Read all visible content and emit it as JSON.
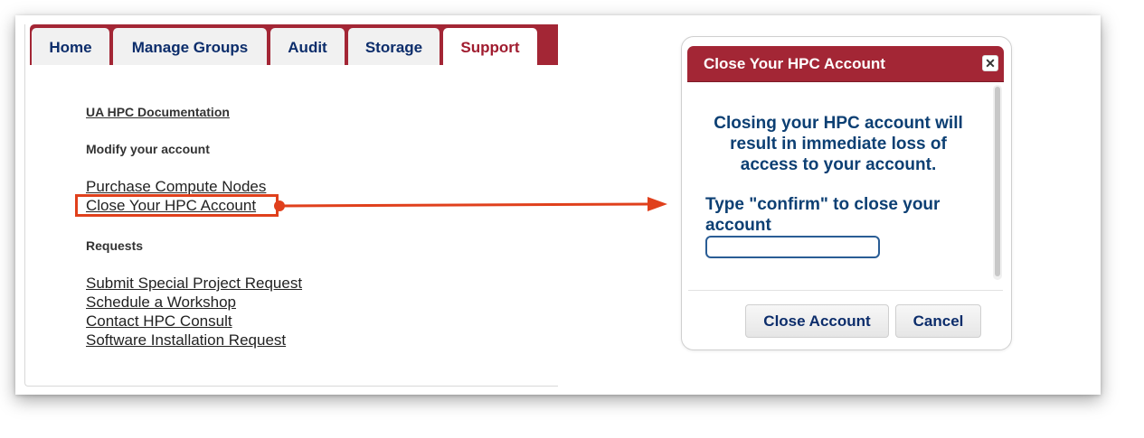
{
  "tabs": [
    {
      "label": "Home"
    },
    {
      "label": "Manage Groups"
    },
    {
      "label": "Audit"
    },
    {
      "label": "Storage"
    },
    {
      "label": "Support"
    }
  ],
  "support": {
    "doc_link": "UA HPC Documentation",
    "modify_heading": "Modify your account",
    "modify_links": [
      "Purchase Compute Nodes",
      "Close Your HPC Account"
    ],
    "requests_heading": "Requests",
    "request_links": [
      "Submit Special Project Request",
      "Schedule a Workshop",
      "Contact HPC Consult",
      "Software Installation Request"
    ]
  },
  "dialog": {
    "title": "Close Your HPC Account",
    "close_icon": "close-icon",
    "warning": "Closing your HPC account will result in immediate loss of access to your account.",
    "confirm_label": "Type \"confirm\" to close your account",
    "confirm_value": "",
    "buttons": {
      "close": "Close Account",
      "cancel": "Cancel"
    }
  },
  "colors": {
    "brand_red": "#a32635",
    "nav_blue": "#0c2d6b",
    "dialog_text": "#0c3f73",
    "annotation_orange": "#e0401c"
  }
}
